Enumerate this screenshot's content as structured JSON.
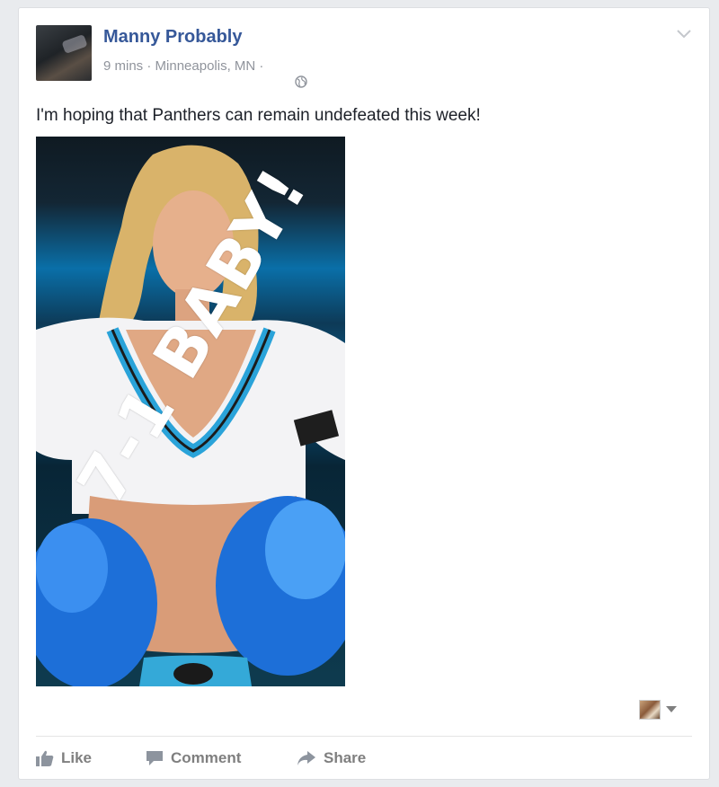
{
  "post": {
    "author": "Manny Probably",
    "time": "9 mins",
    "separator": " · ",
    "location": "Minneapolis, MN",
    "separator2": " · ",
    "text": "I'm hoping that Panthers can remain undefeated this week!",
    "photo_overlay_text": "7-1 BABY!"
  },
  "actions": {
    "like": "Like",
    "comment": "Comment",
    "share": "Share"
  },
  "icons": {
    "audience": "globe-icon",
    "options": "chevron-down-icon",
    "like": "thumbs-up-icon",
    "comment": "speech-bubble-icon",
    "share": "share-arrow-icon",
    "reactor_menu": "caret-down-icon"
  },
  "colors": {
    "author_link": "#365899",
    "meta_text": "#90949c",
    "body_text": "#1d2129",
    "action_text": "#7f7f7f"
  }
}
